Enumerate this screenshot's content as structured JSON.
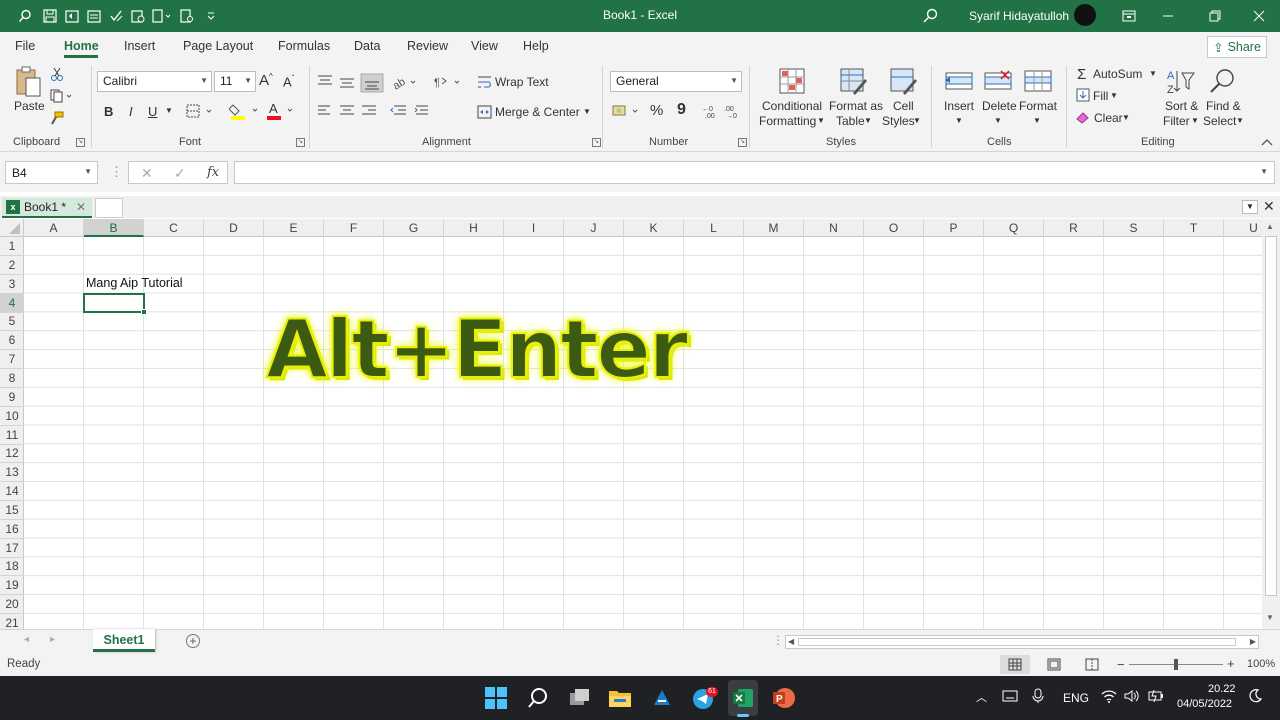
{
  "title_bar": {
    "document_title": "Book1  -  Excel",
    "user_name": "Syarif Hidayatulloh",
    "qat_icons": [
      "search-icon",
      "save-icon",
      "undo-icon",
      "redo-icon",
      "checkbox-icon",
      "paste-icon",
      "open-icon",
      "more-icon"
    ]
  },
  "ribbon_tabs": [
    "File",
    "Home",
    "Insert",
    "Page Layout",
    "Formulas",
    "Data",
    "Review",
    "View",
    "Help"
  ],
  "share_label": "Share",
  "clipboard": {
    "paste": "Paste",
    "group": "Clipboard"
  },
  "font": {
    "name": "Calibri",
    "size": "11",
    "group": "Font",
    "bold": "B",
    "italic": "I",
    "underline": "U",
    "font_color_glyph": "A"
  },
  "alignment": {
    "wrap_text": "Wrap Text",
    "merge_center": "Merge & Center",
    "group": "Alignment"
  },
  "number": {
    "format": "General",
    "percent": "%",
    "comma": "9",
    "group": "Number"
  },
  "styles": {
    "conditional_1": "Conditional",
    "conditional_2": "Formatting",
    "format_table_1": "Format as",
    "format_table_2": "Table",
    "cell_styles_1": "Cell",
    "cell_styles_2": "Styles",
    "group": "Styles"
  },
  "cells_group": {
    "insert": "Insert",
    "delete": "Delete",
    "format": "Format",
    "group": "Cells"
  },
  "editing": {
    "autosum": "AutoSum",
    "fill": "Fill",
    "clear": "Clear",
    "sort_1": "Sort &",
    "sort_2": "Filter",
    "find_1": "Find &",
    "find_2": "Select",
    "group": "Editing"
  },
  "formula_bar": {
    "name_box": "B4",
    "fx": "fx",
    "value": ""
  },
  "workbook_tab": {
    "name": "Book1 *"
  },
  "columns": [
    "A",
    "B",
    "C",
    "D",
    "E",
    "F",
    "G",
    "H",
    "I",
    "J",
    "K",
    "L",
    "M",
    "N",
    "O",
    "P",
    "Q",
    "R",
    "S",
    "T",
    "U"
  ],
  "rows": [
    "1",
    "2",
    "3",
    "4",
    "5",
    "6",
    "7",
    "8",
    "9",
    "10",
    "11",
    "12",
    "13",
    "14",
    "15",
    "16",
    "17",
    "18",
    "19",
    "20",
    "21"
  ],
  "selected": {
    "column": "B",
    "row": "4"
  },
  "cell_content": {
    "B3": "Mang Aip Tutorial"
  },
  "overlay_text": "Alt+Enter",
  "sheet_tabs": [
    "Sheet1"
  ],
  "status": {
    "ready": "Ready",
    "zoom": "100%"
  },
  "taskbar": {
    "telegram_badge": "61",
    "language": "ENG",
    "time": "20.22",
    "date": "04/05/2022"
  },
  "colors": {
    "accent": "#217346",
    "overlay_fill": "#3c5a12",
    "overlay_glow": "#e8f000"
  }
}
